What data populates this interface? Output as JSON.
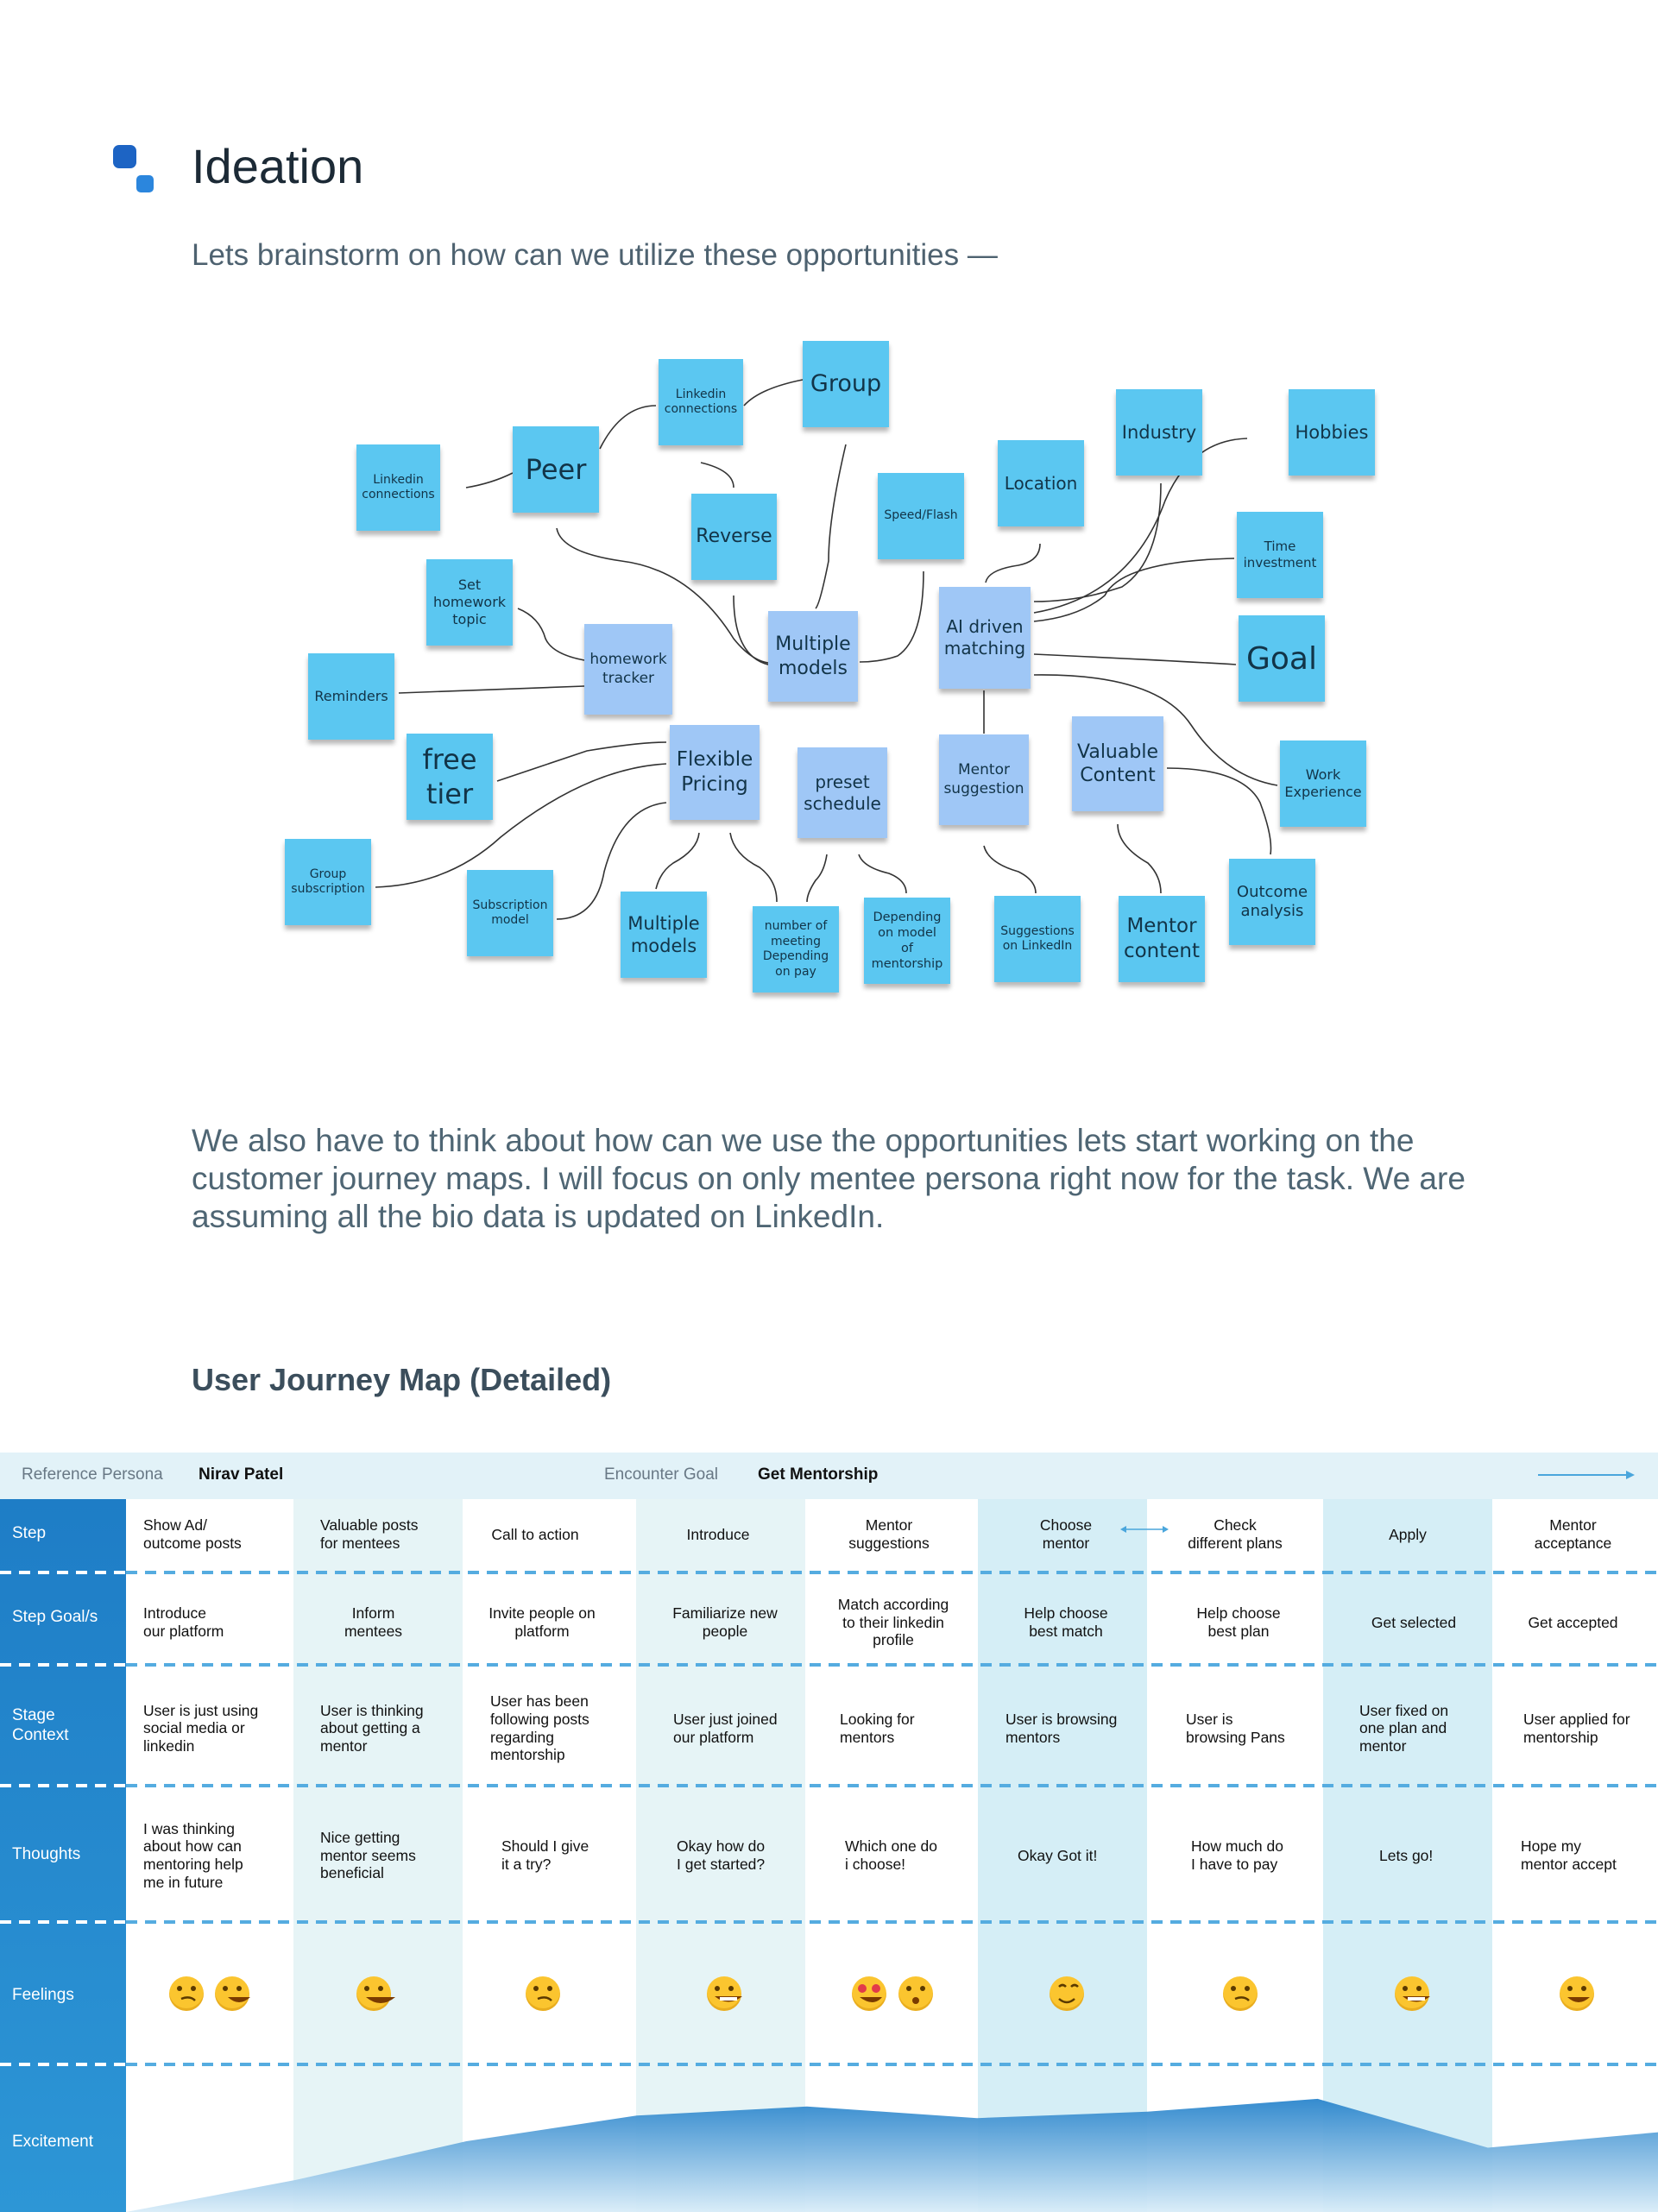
{
  "header": {
    "title": "Ideation",
    "subtitle": "Lets brainstorm on how can we utilize these opportunities —"
  },
  "notes": {
    "linkedin_left": "Linkedin\nconnections",
    "peer": "Peer",
    "linkedin_top": "Linkedin\nconnections",
    "group": "Group",
    "reverse": "Reverse",
    "speed": "Speed/Flash",
    "location": "Location",
    "industry": "Industry",
    "hobbies": "Hobbies",
    "time": "Time\ninvestment",
    "set_homework": "Set\nhomework\ntopic",
    "homework_tracker": "homework\ntracker",
    "multiple_models": "Multiple\nmodels",
    "ai_matching": "AI driven\nmatching",
    "goal": "Goal",
    "reminders": "Reminders",
    "free_tier": "free\ntier",
    "flexible_pricing": "Flexible\nPricing",
    "preset_schedule": "preset\nschedule",
    "mentor_suggestion": "Mentor\nsuggestion",
    "valuable_content": "Valuable\nContent",
    "work_experience": "Work\nExperience",
    "group_subscription": "Group\nsubscription",
    "subscription_model": "Subscription\nmodel",
    "multiple_models_2": "Multiple\nmodels",
    "number_meeting": "number of\nmeeting\nDepending\non pay",
    "depending_model": "Depending\non model\nof\nmentorship",
    "suggestions_linkedin": "Suggestions\non LinkedIn",
    "mentor_content": "Mentor\ncontent",
    "outcome_analysis": "Outcome\nanalysis"
  },
  "paragraph": "We also have to think about how can we use the opportunities lets start working on the customer journey maps. I will focus on only mentee persona right now for the task. We are assuming all the bio data is updated on LinkedIn.",
  "journey": {
    "title": "User Journey Map (Detailed)",
    "persona_label": "Reference Persona",
    "persona_value": "Nirav Patel",
    "goal_label": "Encounter Goal",
    "goal_value": "Get Mentorship",
    "row_headers": [
      "Step",
      "Step Goal/s",
      "Stage\nContext",
      "Thoughts",
      "Feelings",
      "Excitement"
    ],
    "steps": [
      "Show Ad/\noutcome posts",
      "Valuable posts\nfor mentees",
      "Call to action",
      "Introduce",
      "Mentor\nsuggestions",
      "Choose\nmentor",
      "Check\ndifferent plans",
      "Apply",
      "Mentor\nacceptance"
    ],
    "goals": [
      "Introduce\nour platform",
      "Inform\nmentees",
      "Invite people on\nplatform",
      "Familiarize new\npeople",
      "Match according\nto their linkedin\nprofile",
      "Help choose\nbest match",
      "Help choose\nbest plan",
      "Get selected",
      "Get accepted"
    ],
    "contexts": [
      "User is just using\nsocial media or\nlinkedin",
      "User is thinking\nabout getting a\nmentor",
      "User has been\nfollowing posts\nregarding\nmentorship",
      "User just joined\nour platform",
      "Looking for\nmentors",
      "User is browsing\nmentors",
      "User is\nbrowsing Pans",
      "User fixed on\none plan and\nmentor",
      "User applied for\nmentorship"
    ],
    "thoughts": [
      "I was thinking\nabout how can\nmentoring help\nme in future",
      "Nice getting\nmentor seems\nbeneficial",
      "Should I give\nit a try?",
      "Okay how do\nI get started?",
      "Which one do\ni choose!",
      "Okay Got it!",
      "How much do\nI have to pay",
      "Lets go!",
      "Hope my\nmentor accept"
    ],
    "feelings": [
      [
        "thinking-emoji",
        "sweat-smile-emoji"
      ],
      [
        "grinning-emoji"
      ],
      [
        "thinking-emoji"
      ],
      [
        "grin-emoji"
      ],
      [
        "heart-eyes-emoji",
        "flushed-emoji"
      ],
      [
        "smiling-blush-emoji"
      ],
      [
        "thinking-emoji"
      ],
      [
        "grin-emoji"
      ],
      [
        "sweat-smile-emoji"
      ]
    ],
    "excitement": [
      0.0,
      0.25,
      0.55,
      0.75,
      0.82,
      0.73,
      0.78,
      0.88,
      0.5,
      0.62
    ],
    "colors": {
      "header_dark": "#1e7dc6",
      "header_light": "#2e97d6",
      "accent": "#4aa6dc",
      "note": "#5bc7f1",
      "note_hub": "#9fc7f6"
    }
  }
}
